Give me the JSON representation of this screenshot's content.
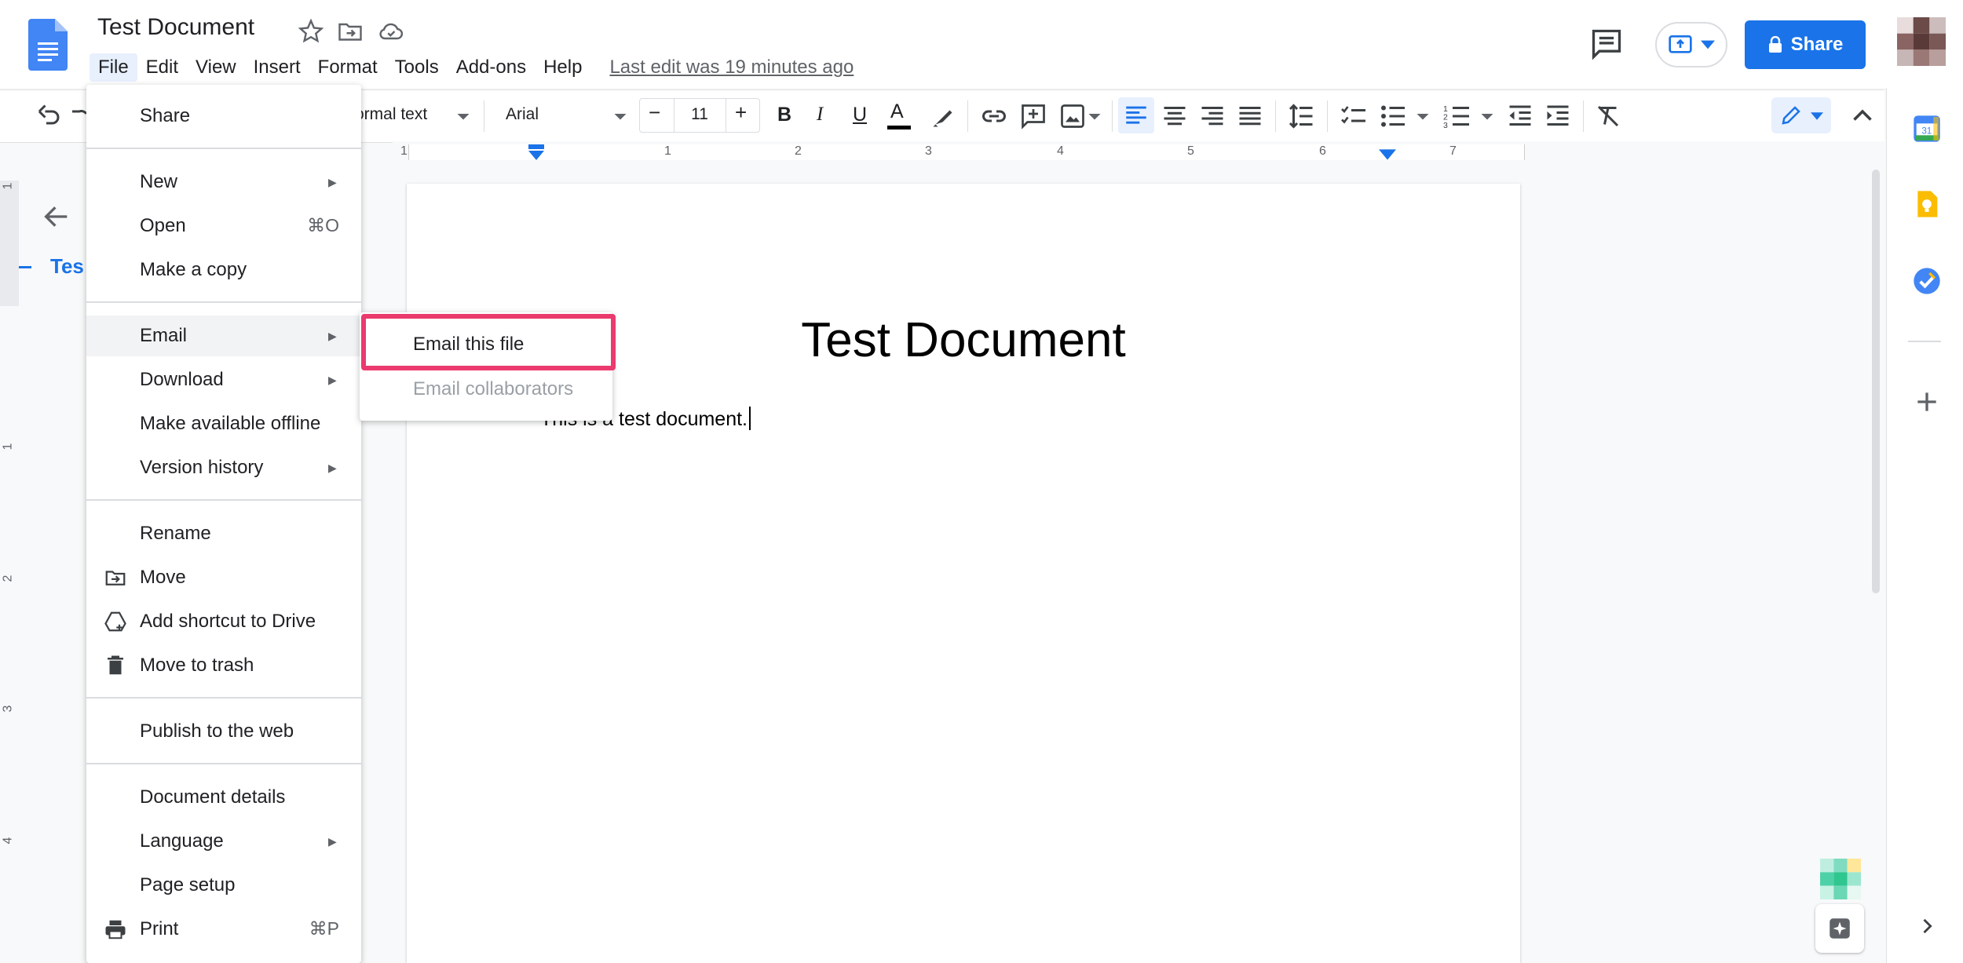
{
  "document": {
    "title": "Test Document",
    "heading": "Test Document",
    "body_text": "This is a test document.",
    "outline_item": "Tes"
  },
  "menubar": {
    "items": [
      "File",
      "Edit",
      "View",
      "Insert",
      "Format",
      "Tools",
      "Add-ons",
      "Help"
    ],
    "last_edit": "Last edit was 19 minutes ago"
  },
  "header": {
    "share_label": "Share"
  },
  "toolbar": {
    "style_label": "ormal text",
    "font_label": "Arial",
    "font_size": "11",
    "minus": "−",
    "plus": "+",
    "bold": "B",
    "italic": "I",
    "underline": "U",
    "text_color": "A"
  },
  "ruler": {
    "h_labels": [
      "1",
      "1",
      "2",
      "3",
      "4",
      "5",
      "6",
      "7"
    ],
    "v_labels": [
      "1",
      "1",
      "2",
      "3",
      "4"
    ]
  },
  "file_menu": {
    "share": "Share",
    "new": "New",
    "open": "Open",
    "open_shortcut": "⌘O",
    "make_copy": "Make a copy",
    "email": "Email",
    "download": "Download",
    "make_offline": "Make available offline",
    "version_history": "Version history",
    "rename": "Rename",
    "move": "Move",
    "add_shortcut": "Add shortcut to Drive",
    "move_trash": "Move to trash",
    "publish": "Publish to the web",
    "doc_details": "Document details",
    "language": "Language",
    "page_setup": "Page setup",
    "print": "Print",
    "print_shortcut": "⌘P"
  },
  "email_submenu": {
    "email_this_file": "Email this file",
    "email_collaborators": "Email collaborators"
  },
  "colors": {
    "accent": "#1a73e8",
    "highlight_border": "#ea3a6e",
    "menu_hover": "#f1f3f4",
    "disabled_text": "#9aa0a6"
  }
}
